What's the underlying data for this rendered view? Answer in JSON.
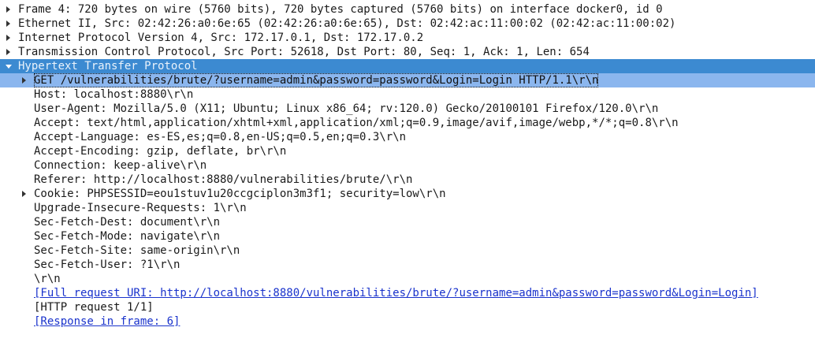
{
  "tree": {
    "frame": "Frame 4: 720 bytes on wire (5760 bits), 720 bytes captured (5760 bits) on interface docker0, id 0",
    "ethernet": "Ethernet II, Src: 02:42:26:a0:6e:65 (02:42:26:a0:6e:65), Dst: 02:42:ac:11:00:02 (02:42:ac:11:00:02)",
    "ipv4": "Internet Protocol Version 4, Src: 172.17.0.1, Dst: 172.17.0.2",
    "tcp": "Transmission Control Protocol, Src Port: 52618, Dst Port: 80, Seq: 1, Ack: 1, Len: 654",
    "http": "Hypertext Transfer Protocol",
    "http_fields": {
      "request_line": "GET /vulnerabilities/brute/?username=admin&password=password&Login=Login HTTP/1.1\\r\\n",
      "host": "Host: localhost:8880\\r\\n",
      "user_agent": "User-Agent: Mozilla/5.0 (X11; Ubuntu; Linux x86_64; rv:120.0) Gecko/20100101 Firefox/120.0\\r\\n",
      "accept": "Accept: text/html,application/xhtml+xml,application/xml;q=0.9,image/avif,image/webp,*/*;q=0.8\\r\\n",
      "accept_language": "Accept-Language: es-ES,es;q=0.8,en-US;q=0.5,en;q=0.3\\r\\n",
      "accept_encoding": "Accept-Encoding: gzip, deflate, br\\r\\n",
      "connection": "Connection: keep-alive\\r\\n",
      "referer": "Referer: http://localhost:8880/vulnerabilities/brute/\\r\\n",
      "cookie": "Cookie: PHPSESSID=eou1stuv1u20ccgciplon3m3f1; security=low\\r\\n",
      "upgrade_insecure": "Upgrade-Insecure-Requests: 1\\r\\n",
      "sec_fetch_dest": "Sec-Fetch-Dest: document\\r\\n",
      "sec_fetch_mode": "Sec-Fetch-Mode: navigate\\r\\n",
      "sec_fetch_site": "Sec-Fetch-Site: same-origin\\r\\n",
      "sec_fetch_user": "Sec-Fetch-User: ?1\\r\\n",
      "crlf": "\\r\\n",
      "full_uri": "[Full request URI: http://localhost:8880/vulnerabilities/brute/?username=admin&password=password&Login=Login]",
      "request_count": "[HTTP request 1/1]",
      "response_in": "[Response in frame: 6]"
    }
  },
  "icons": {
    "collapsed": "chevron-right-icon",
    "expanded": "chevron-down-icon"
  },
  "colors": {
    "selected_parent_bg": "#3c8ad1",
    "selected_row_bg": "#8bb6ee",
    "link": "#1a33cc"
  }
}
